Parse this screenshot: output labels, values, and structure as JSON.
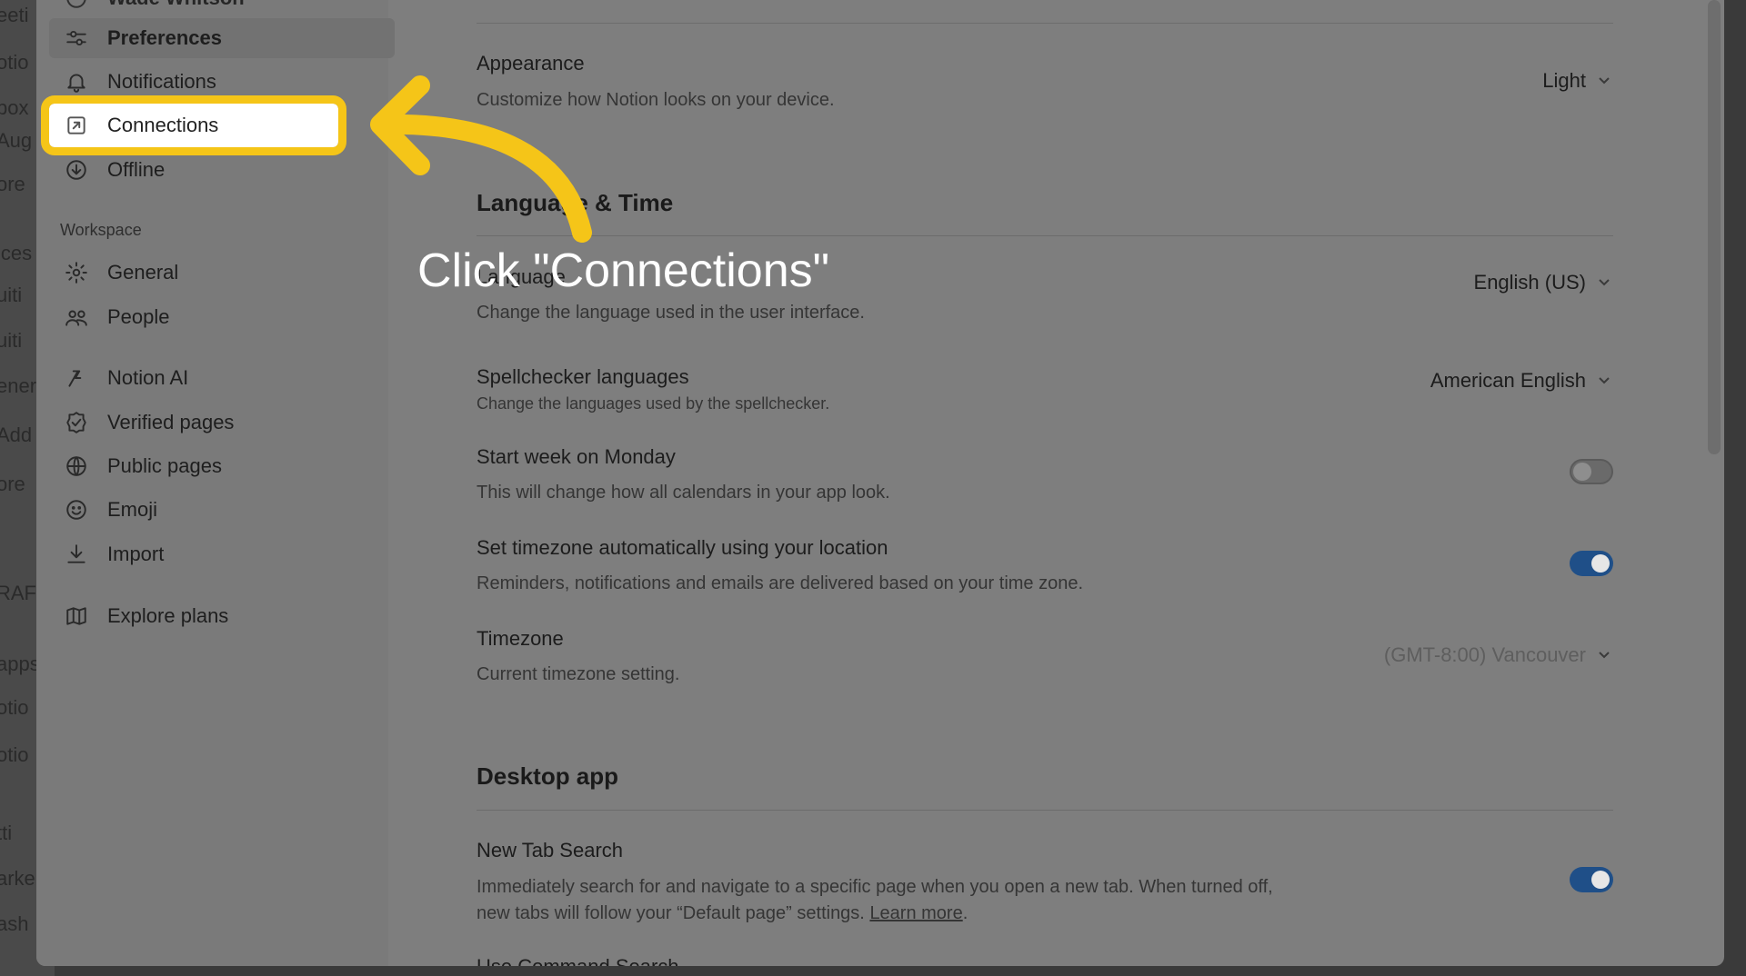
{
  "background_fragments": [
    "eeti",
    "otio",
    "box",
    "Aug",
    "ore",
    "ices",
    "uiti",
    "uiti",
    "ener",
    "Add",
    "ore",
    "RAF",
    "apps",
    "otio",
    "otio",
    "tti",
    "arke",
    "ash"
  ],
  "sidebar": {
    "top_item_partial": "Wade Whitson",
    "items": [
      {
        "label": "Preferences",
        "icon": "sliders-icon"
      },
      {
        "label": "Notifications",
        "icon": "bell-icon"
      },
      {
        "label": "Connections",
        "icon": "external-link-icon"
      },
      {
        "label": "Offline",
        "icon": "download-circle-icon"
      }
    ],
    "workspace_label": "Workspace",
    "workspace_items": [
      {
        "label": "General",
        "icon": "gear-icon"
      },
      {
        "label": "People",
        "icon": "people-icon"
      },
      {
        "label": "Notion AI",
        "icon": "ai-icon"
      },
      {
        "label": "Verified pages",
        "icon": "verified-icon"
      },
      {
        "label": "Public pages",
        "icon": "globe-icon"
      },
      {
        "label": "Emoji",
        "icon": "smiley-icon"
      },
      {
        "label": "Import",
        "icon": "import-icon"
      },
      {
        "label": "Explore plans",
        "icon": "map-icon"
      }
    ]
  },
  "main": {
    "appearance": {
      "title": "Appearance",
      "desc": "Customize how Notion looks on your device.",
      "value": "Light"
    },
    "lang_section": "Language & Time",
    "language": {
      "title": "Language",
      "desc": "Change the language used in the user interface.",
      "value": "English (US)"
    },
    "spellcheck": {
      "title": "Spellchecker languages",
      "desc": "Change the languages used by the spellchecker.",
      "value": "American English"
    },
    "start_week": {
      "title": "Start week on Monday",
      "desc": "This will change how all calendars in your app look.",
      "on": false
    },
    "auto_tz": {
      "title": "Set timezone automatically using your location",
      "desc": "Reminders, notifications and emails are delivered based on your time zone.",
      "on": true
    },
    "timezone": {
      "title": "Timezone",
      "desc": "Current timezone setting.",
      "value": "(GMT-8:00) Vancouver"
    },
    "desktop_section": "Desktop app",
    "new_tab": {
      "title": "New Tab Search",
      "desc_line1": "Immediately search for and navigate to a specific page when you open a new tab. When turned off,",
      "desc_line2": "new tabs will follow your “Default page” settings.",
      "link": "Learn more",
      "on": true
    },
    "next_partial": "Use Command Search"
  },
  "overlay": {
    "instruction": "Click \"Connections\"",
    "highlight_color": "#f5c518"
  }
}
